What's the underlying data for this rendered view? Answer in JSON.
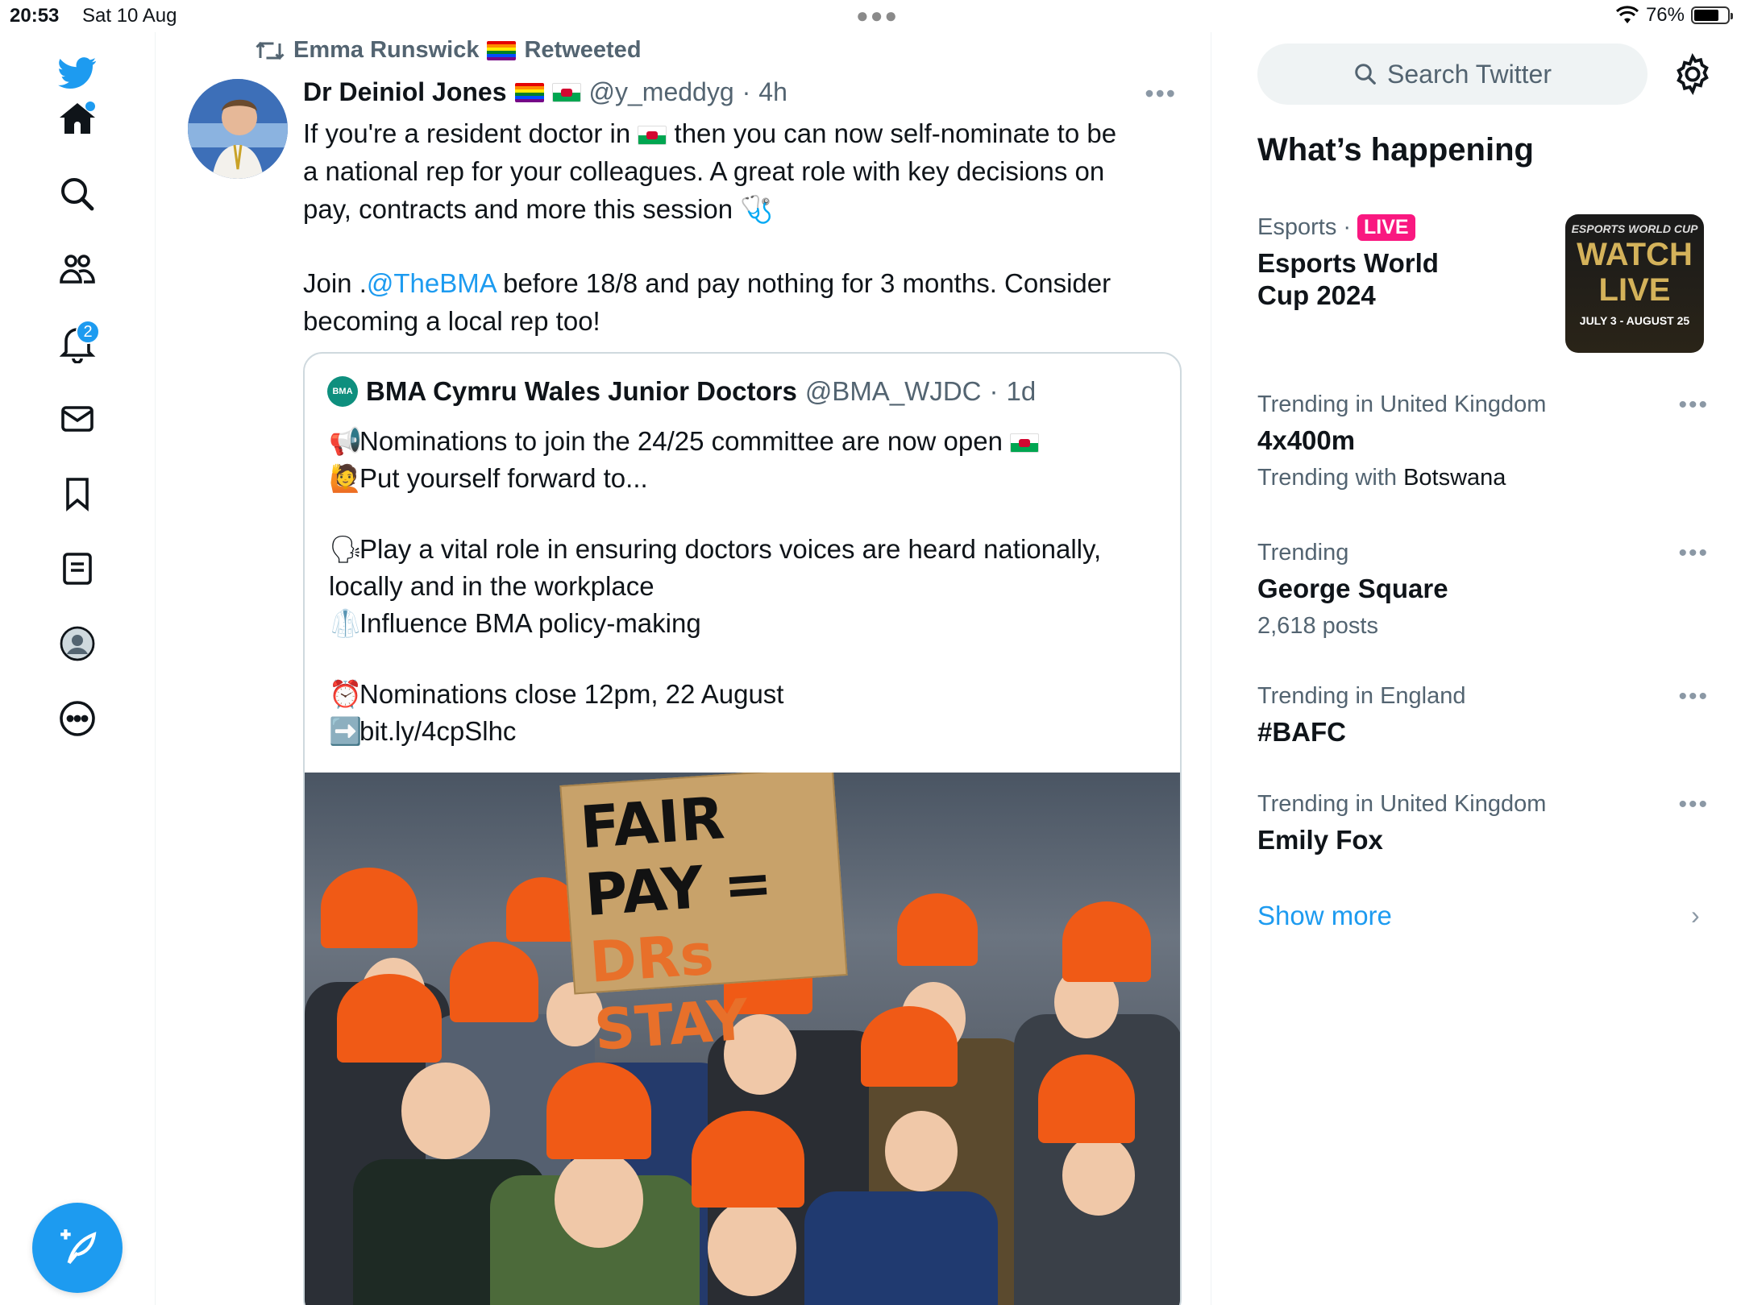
{
  "status_bar": {
    "time": "20:53",
    "date": "Sat 10 Aug",
    "battery": "76%",
    "battery_level": 0.76
  },
  "nav": {
    "notifications_badge": "2",
    "icons": [
      "twitter-bird-icon",
      "home-icon",
      "search-icon",
      "communities-icon",
      "notifications-icon",
      "messages-icon",
      "bookmarks-icon",
      "lists-icon",
      "profile-icon",
      "more-icon",
      "compose-icon"
    ]
  },
  "tweet": {
    "retweeted_by": "Emma Runswick",
    "retweeted_label": "Retweeted",
    "author_name": "Dr Deiniol Jones",
    "author_handle": "@y_meddyg",
    "time": "4h",
    "line1_a": "If you're a resident doctor in",
    "line1_b": "then you can now self-nominate to be",
    "line2": "a national rep for your colleagues. A great role with key decisions on",
    "line3": "pay, contracts and more this session",
    "line4_a": "Join .",
    "line4_link": "@TheBMA",
    "line4_b": " before 18/8 and pay nothing for 3 months. Consider",
    "line5": "becoming a local rep too!"
  },
  "quote": {
    "logo_text": "BMA",
    "author_name": "BMA Cymru Wales Junior Doctors",
    "author_handle": "@BMA_WJDC",
    "time": "1d",
    "line1": "Nominations to join the 24/25 committee are now open",
    "line2": "Put yourself forward to...",
    "line3": "Play a vital role in ensuring doctors voices are heard nationally,",
    "line4": "locally and in the workplace",
    "line5": "Influence BMA policy-making",
    "line6": "Nominations close 12pm, 22 August",
    "line7": "bit.ly/4cpSlhc",
    "image_sign_line1": "FAIR",
    "image_sign_line2": "PAY =",
    "image_sign_line3": "DRs STAY"
  },
  "sidebar": {
    "search_placeholder": "Search Twitter",
    "heading": "What’s happening",
    "show_more": "Show more",
    "trends": [
      {
        "category": "Esports",
        "live": "LIVE",
        "title_line1": "Esports World",
        "title_line2": "Cup 2024"
      },
      {
        "category": "Trending in United Kingdom",
        "title": "4x400m",
        "sub_prefix": "Trending with",
        "sub_term": "Botswana"
      },
      {
        "category": "Trending",
        "title": "George Square",
        "sub": "2,618 posts"
      },
      {
        "category": "Trending in England",
        "title": "#BAFC"
      },
      {
        "category": "Trending in United Kingdom",
        "title": "Emily Fox"
      }
    ],
    "thumb": {
      "top": "ESPORTS WORLD CUP",
      "main1": "WATCH",
      "main2": "LIVE",
      "dates": "JULY 3 - AUGUST 25"
    }
  },
  "colors": {
    "accent": "#1d9bf0",
    "live": "#f91880",
    "muted": "#536471"
  }
}
